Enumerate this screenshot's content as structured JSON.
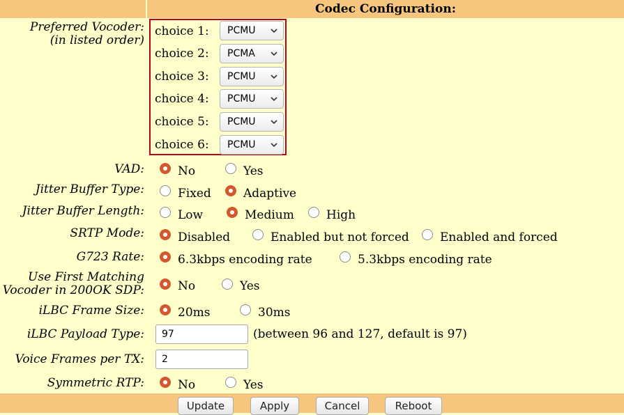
{
  "header": {
    "title": "Codec Configuration:"
  },
  "vocoder": {
    "label_line1": "Preferred Vocoder:",
    "label_line2": "(in listed order)",
    "choices": [
      {
        "label": "choice 1:",
        "value": "PCMU"
      },
      {
        "label": "choice 2:",
        "value": "PCMA"
      },
      {
        "label": "choice 3:",
        "value": "PCMU"
      },
      {
        "label": "choice 4:",
        "value": "PCMU"
      },
      {
        "label": "choice 5:",
        "value": "PCMU"
      },
      {
        "label": "choice 6:",
        "value": "PCMU"
      }
    ]
  },
  "vad": {
    "label": "VAD:",
    "options": [
      "No",
      "Yes"
    ],
    "selected": "No"
  },
  "jitter_type": {
    "label": "Jitter Buffer Type:",
    "options": [
      "Fixed",
      "Adaptive"
    ],
    "selected": "Adaptive"
  },
  "jitter_length": {
    "label": "Jitter Buffer Length:",
    "options": [
      "Low",
      "Medium",
      "High"
    ],
    "selected": "Medium"
  },
  "srtp": {
    "label": "SRTP Mode:",
    "options": [
      "Disabled",
      "Enabled but not forced",
      "Enabled and forced"
    ],
    "selected": "Disabled"
  },
  "g723": {
    "label": "G723 Rate:",
    "options": [
      "6.3kbps encoding rate",
      "5.3kbps encoding rate"
    ],
    "selected": "6.3kbps encoding rate"
  },
  "first_match": {
    "label_line1": "Use First Matching",
    "label_line2": "Vocoder in 200OK SDP:",
    "options": [
      "No",
      "Yes"
    ],
    "selected": "No"
  },
  "ilbc_frame": {
    "label": "iLBC Frame Size:",
    "options": [
      "20ms",
      "30ms"
    ],
    "selected": "20ms"
  },
  "ilbc_payload": {
    "label": "iLBC Payload Type:",
    "value": "97",
    "hint": "(between 96 and 127, default is 97)"
  },
  "voice_frames": {
    "label": "Voice Frames per TX:",
    "value": "2"
  },
  "symmetric_rtp": {
    "label": "Symmetric RTP:",
    "options": [
      "No",
      "Yes"
    ],
    "selected": "No"
  },
  "buttons": {
    "update": "Update",
    "apply": "Apply",
    "cancel": "Cancel",
    "reboot": "Reboot"
  },
  "colors": {
    "background": "#FFFFCC",
    "header": "#F7C67E",
    "radio_selected": "#D2582D",
    "highlight_border": "#C0001A"
  }
}
